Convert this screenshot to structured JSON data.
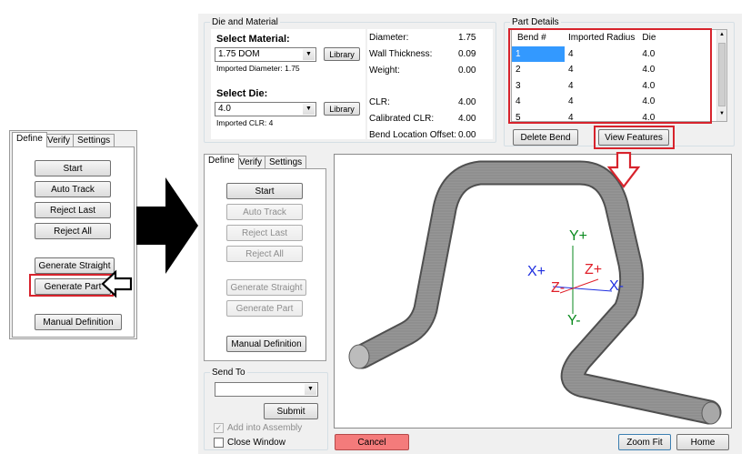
{
  "small_window": {
    "tabs": [
      "Define",
      "Verify",
      "Settings"
    ],
    "buttons": {
      "start": "Start",
      "auto_track": "Auto Track",
      "reject_last": "Reject Last",
      "reject_all": "Reject All",
      "generate_straight": "Generate Straight",
      "generate_part": "Generate Part",
      "manual_definition": "Manual Definition"
    }
  },
  "die_material": {
    "title": "Die and Material",
    "select_material_label": "Select Material:",
    "material_value": "1.75 DOM",
    "library_label": "Library",
    "imported_diameter": "Imported Diameter: 1.75",
    "select_die_label": "Select Die:",
    "die_value": "4.0",
    "imported_clr": "Imported CLR: 4",
    "properties": [
      {
        "label": "Diameter:",
        "value": "1.75"
      },
      {
        "label": "Wall Thickness:",
        "value": "0.09"
      },
      {
        "label": "Weight:",
        "value": "0.00"
      },
      {
        "label": "CLR:",
        "value": "4.00"
      },
      {
        "label": "Calibrated CLR:",
        "value": "4.00"
      },
      {
        "label": "Bend Location Offset:",
        "value": "0.00"
      }
    ]
  },
  "part_details": {
    "title": "Part Details",
    "columns": [
      "Bend #",
      "Imported Radius",
      "Die"
    ],
    "rows": [
      [
        "1",
        "4",
        "4.0"
      ],
      [
        "2",
        "4",
        "4.0"
      ],
      [
        "3",
        "4",
        "4.0"
      ],
      [
        "4",
        "4",
        "4.0"
      ],
      [
        "5",
        "4",
        "4.0"
      ]
    ],
    "delete_bend": "Delete Bend",
    "view_features": "View Features"
  },
  "define_panel": {
    "tabs": [
      "Define",
      "Verify",
      "Settings"
    ],
    "buttons": {
      "start": "Start",
      "auto_track": "Auto Track",
      "reject_last": "Reject Last",
      "reject_all": "Reject All",
      "generate_straight": "Generate Straight",
      "generate_part": "Generate Part",
      "manual_definition": "Manual Definition"
    }
  },
  "send_to": {
    "title": "Send To",
    "select_value": "",
    "submit": "Submit",
    "add_into_assembly": "Add into Assembly",
    "close_window": "Close Window"
  },
  "viewport": {
    "axes": {
      "y_plus": "Y+",
      "y_minus": "Y-",
      "x_plus": "X+",
      "x_minus": "X-",
      "z_plus": "Z+",
      "z_minus": "Z-"
    },
    "colors": {
      "x": "#1f2fe0",
      "y": "#0a8a1e",
      "z": "#e0202a"
    }
  },
  "bottom_bar": {
    "cancel": "Cancel",
    "zoom_fit": "Zoom Fit",
    "home": "Home"
  },
  "accent": {
    "highlight_red": "#d7232c",
    "cancel_bg": "#f47b7b",
    "selection": "#3399ff"
  }
}
